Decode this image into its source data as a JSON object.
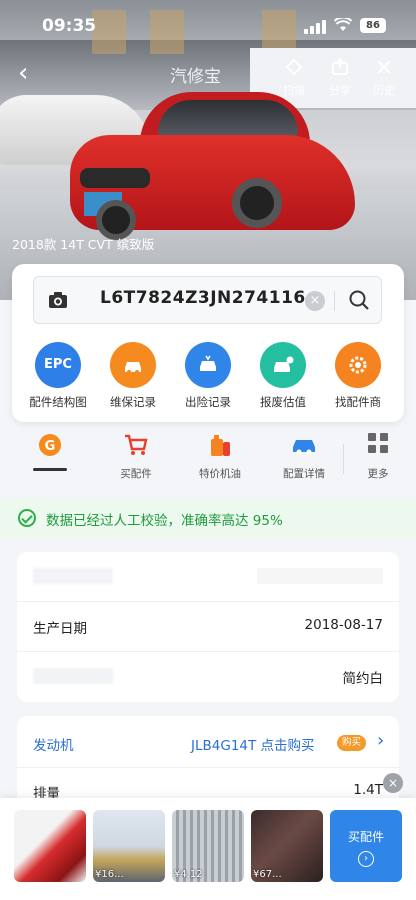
{
  "status_bar": {
    "time": "09:35",
    "battery": "86"
  },
  "nav": {
    "back_glyph": "‹",
    "title": "汽修宝",
    "actions": [
      {
        "label": "扫描",
        "icon": "scan-icon"
      },
      {
        "label": "分享",
        "icon": "share-icon"
      },
      {
        "label": "历史",
        "icon": "history-icon"
      }
    ]
  },
  "hero": {
    "caption": "2018款 14T CVT 缤致版"
  },
  "vin": {
    "value": "L6T7824Z3JN274116",
    "clear_glyph": "×"
  },
  "functions": [
    {
      "label": "配件结构图",
      "icon_text": "EPC",
      "color": "#2f7fe8"
    },
    {
      "label": "维保记录",
      "icon_text": "",
      "color": "#f58a1f"
    },
    {
      "label": "出险记录",
      "icon_text": "",
      "color": "#2f86e8"
    },
    {
      "label": "报废估值",
      "icon_text": "",
      "color": "#23bfa0"
    },
    {
      "label": "找配件商",
      "icon_text": "",
      "color": "#f5831f"
    }
  ],
  "secondary": [
    {
      "label": "",
      "icon": "brand-logo-icon"
    },
    {
      "label": "买配件",
      "icon": "cart-icon"
    },
    {
      "label": "特价机油",
      "icon": "oil-icon"
    },
    {
      "label": "配置详情",
      "icon": "car-config-icon"
    },
    {
      "label": "更多",
      "icon": "grid-icon"
    }
  ],
  "verified_banner": "数据已经过人工校验，准确率高达 95%",
  "info": [
    {
      "key": "",
      "value": ""
    },
    {
      "key": "生产日期",
      "value": "2018-08-17"
    },
    {
      "key": "",
      "value": "简约白"
    }
  ],
  "engine": {
    "label": "发动机",
    "value": "JLB4G14T 点击购买",
    "badge": "购买"
  },
  "displacement": {
    "label": "排量",
    "value": "1.4T"
  },
  "products": [
    {
      "price": ""
    },
    {
      "price": "¥16..."
    },
    {
      "price": "¥4.12"
    },
    {
      "price": "¥67..."
    }
  ],
  "buy_button": {
    "label": "买配件",
    "arrow": "›"
  },
  "close_glyph": "×"
}
